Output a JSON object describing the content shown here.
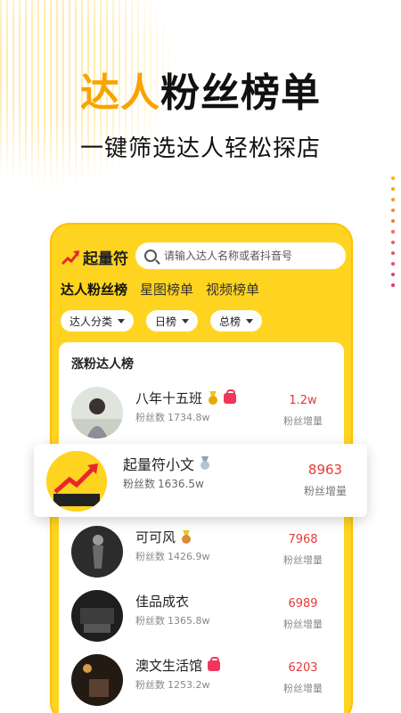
{
  "hero": {
    "title_accent": "达人",
    "title_rest": "粉丝榜单",
    "subtitle": "一键筛选达人轻松探店"
  },
  "app": {
    "logo_text": "起量符",
    "search_placeholder": "请输入达人名称或者抖音号"
  },
  "tabs": [
    {
      "label": "达人粉丝榜",
      "active": true
    },
    {
      "label": "星图榜单",
      "active": false
    },
    {
      "label": "视频榜单",
      "active": false
    }
  ],
  "filters": [
    {
      "label": "达人分类"
    },
    {
      "label": "日榜"
    },
    {
      "label": "总榜"
    }
  ],
  "list": {
    "title": "涨粉达人榜",
    "fans_label": "粉丝数",
    "growth_label": "粉丝增量",
    "rows": [
      {
        "name": "八年十五班",
        "fans": "1734.8w",
        "growth": "1.2w",
        "medal": "gold",
        "shop": true
      },
      {
        "name": "起量符小文",
        "fans": "1636.5w",
        "growth": "8963",
        "medal": "silver",
        "shop": false
      },
      {
        "name": "可可风",
        "fans": "1426.9w",
        "growth": "7968",
        "medal": "bronze",
        "shop": false
      },
      {
        "name": "佳品成衣",
        "fans": "1365.8w",
        "growth": "6989",
        "medal": "",
        "shop": false
      },
      {
        "name": "澳文生活馆",
        "fans": "1253.2w",
        "growth": "6203",
        "medal": "",
        "shop": true
      }
    ]
  },
  "colors": {
    "brand_yellow": "#ffd420",
    "accent_orange": "#f7a400",
    "growth_red": "#e53935"
  }
}
